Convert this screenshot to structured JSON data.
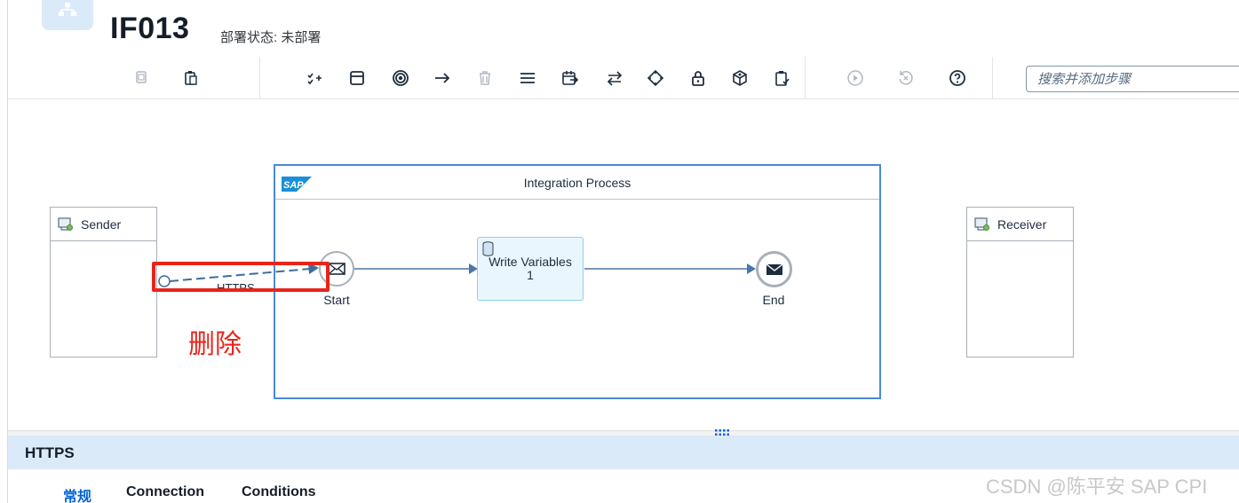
{
  "header": {
    "title": "IF013",
    "deploy_status": "部署状态: 未部署"
  },
  "toolbar": {
    "search_placeholder": "搜索并添加步骤"
  },
  "canvas": {
    "sender_label": "Sender",
    "receiver_label": "Receiver",
    "process_title": "Integration Process",
    "start_label": "Start",
    "end_label": "End",
    "task_label_line1": "Write Variables",
    "task_label_line2": "1",
    "connection_label": "HTTPS",
    "delete_note": "删除"
  },
  "panel": {
    "title": "HTTPS",
    "tabs": [
      "常规",
      "Connection",
      "Conditions"
    ]
  },
  "watermark": "CSDN @陈平安 SAP CPI",
  "colors": {
    "accent": "#0064d9",
    "process_border": "#4a8ad4",
    "highlight": "#e8241a",
    "panel_header_bg": "#dbeaf8"
  }
}
